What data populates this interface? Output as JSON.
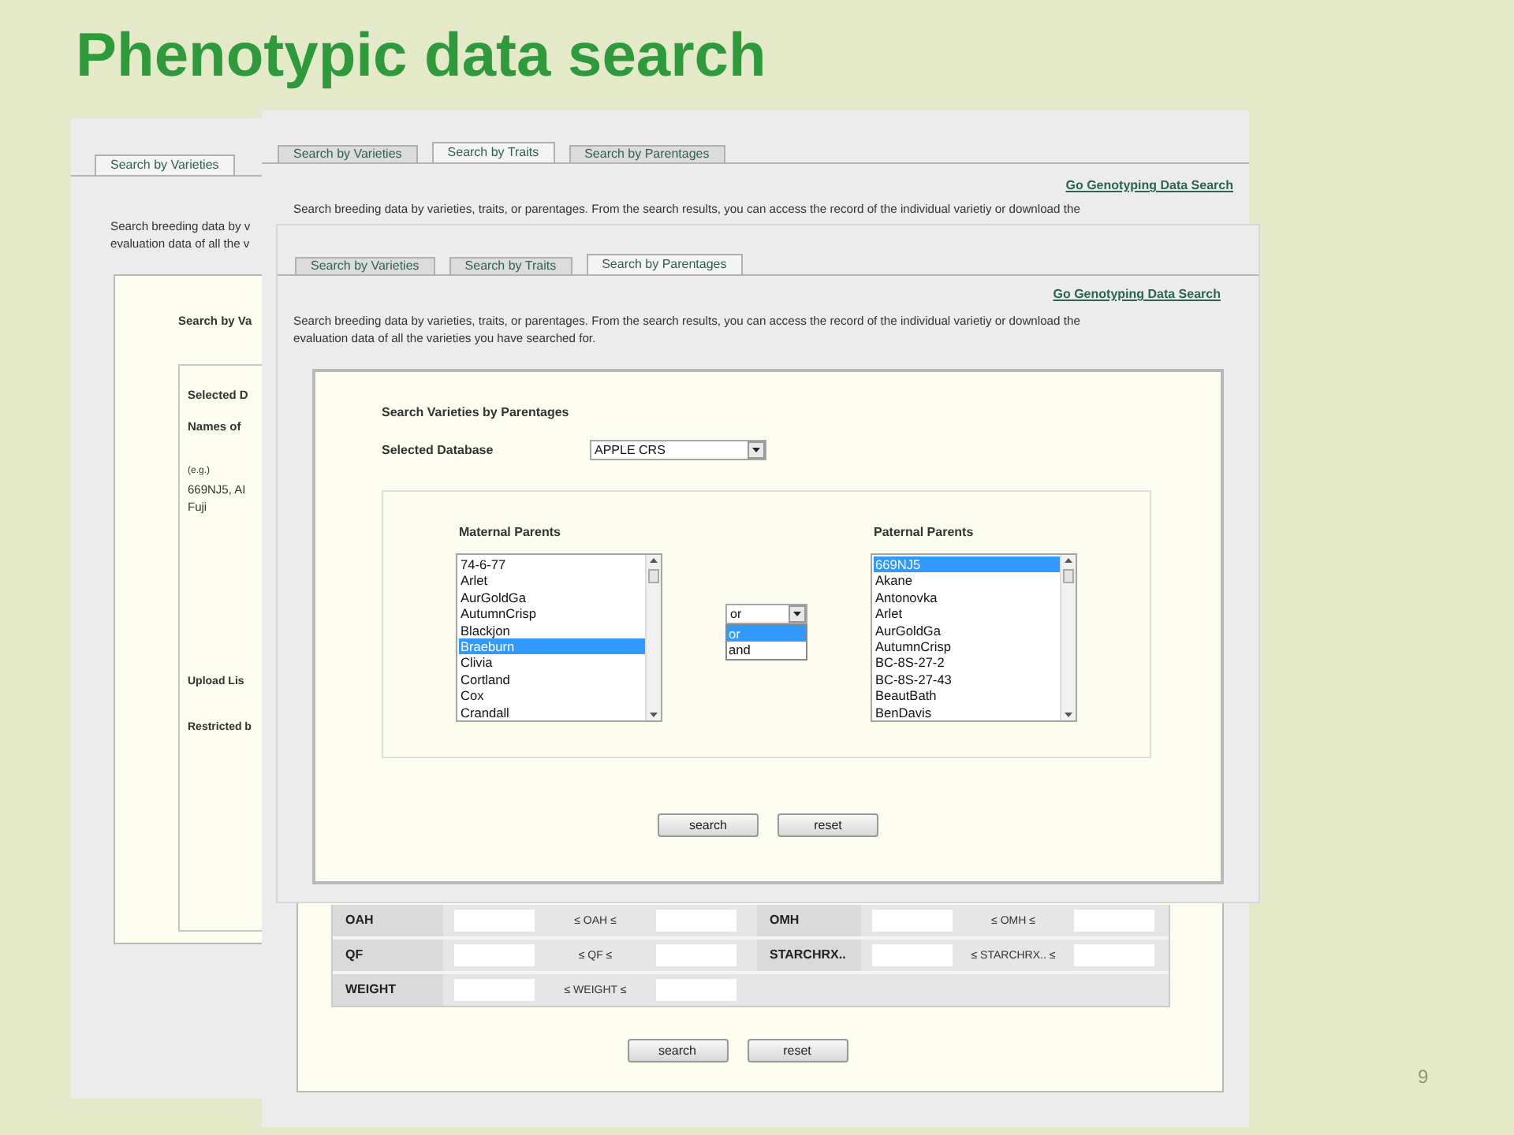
{
  "title": "Phenotypic data search",
  "varieties_page": {
    "tabs": [
      {
        "label": "Search by Varieties",
        "selected": true
      }
    ],
    "intro": [
      "Search breeding data by v",
      "evaluation data of all the v"
    ],
    "heading": "Search by Va",
    "labels": [
      "Selected D",
      "Names of"
    ],
    "example_label": "(e.g.)",
    "examples": [
      "669NJ5, AI",
      "Fuji"
    ],
    "upload_label": "Upload Lis",
    "restricted_label": "Restricted b"
  },
  "traits_page": {
    "tabs": [
      {
        "label": "Search by Varieties",
        "selected": false
      },
      {
        "label": "Search by Traits",
        "selected": true
      },
      {
        "label": "Search by Parentages",
        "selected": false
      }
    ],
    "link": "Go Genotyping Data Search",
    "intro": "Search breeding data by varieties, traits, or parentages. From the search results, you can access the record of the individual varietiy or download the",
    "trait_rows": [
      [
        {
          "name": "OAH",
          "range": "≤ OAH ≤"
        },
        {
          "name": "OMH",
          "range": "≤ OMH ≤"
        }
      ],
      [
        {
          "name": "QF",
          "range": "≤ QF ≤"
        },
        {
          "name": "STARCHRX..",
          "range": "≤ STARCHRX.. ≤"
        }
      ],
      [
        {
          "name": "WEIGHT",
          "range": "≤ WEIGHT ≤"
        }
      ]
    ],
    "buttons": [
      "search",
      "reset"
    ]
  },
  "parentages_page": {
    "tabs": [
      {
        "label": "Search by Varieties",
        "selected": false
      },
      {
        "label": "Search by Traits",
        "selected": false
      },
      {
        "label": "Search by Parentages",
        "selected": true
      }
    ],
    "link": "Go Genotyping Data Search",
    "intro": [
      "Search breeding data by varieties, traits, or parentages. From the search results, you can access the record of the individual varietiy or download the",
      "evaluation data of all the varieties you have searched for."
    ],
    "heading": "Search Varieties by Parentages",
    "database_label": "Selected Database",
    "database_value": "APPLE CRS",
    "maternal": {
      "label": "Maternal Parents",
      "items": [
        {
          "text": "74-6-77",
          "selected": false
        },
        {
          "text": "Arlet",
          "selected": false
        },
        {
          "text": "AurGoldGa",
          "selected": false
        },
        {
          "text": "AutumnCrisp",
          "selected": false
        },
        {
          "text": "Blackjon",
          "selected": false
        },
        {
          "text": "Braeburn",
          "selected": true
        },
        {
          "text": "Clivia",
          "selected": false
        },
        {
          "text": "Cortland",
          "selected": false
        },
        {
          "text": "Cox",
          "selected": false
        },
        {
          "text": "Crandall",
          "selected": false
        }
      ]
    },
    "operator": {
      "value": "or",
      "options": [
        {
          "label": "or",
          "selected": true
        },
        {
          "label": "and",
          "selected": false
        }
      ]
    },
    "paternal": {
      "label": "Paternal Parents",
      "items": [
        {
          "text": "669NJ5",
          "selected": true
        },
        {
          "text": "Akane",
          "selected": false
        },
        {
          "text": "Antonovka",
          "selected": false
        },
        {
          "text": "Arlet",
          "selected": false
        },
        {
          "text": "AurGoldGa",
          "selected": false
        },
        {
          "text": "AutumnCrisp",
          "selected": false
        },
        {
          "text": "BC-8S-27-2",
          "selected": false
        },
        {
          "text": "BC-8S-27-43",
          "selected": false
        },
        {
          "text": "BeautBath",
          "selected": false
        },
        {
          "text": "BenDavis",
          "selected": false
        }
      ]
    },
    "buttons": [
      "search",
      "reset"
    ]
  },
  "page_number": "9"
}
